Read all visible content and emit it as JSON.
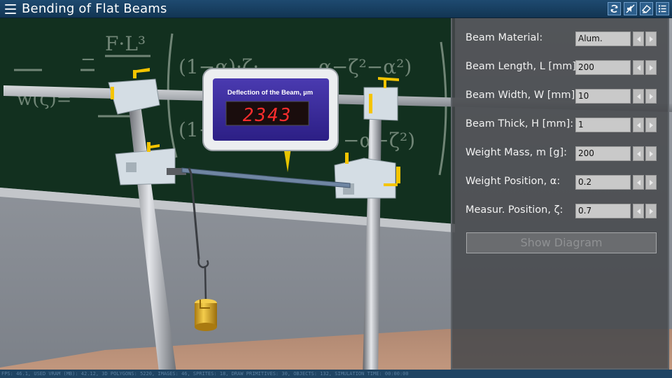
{
  "app": {
    "title": "Bending of Flat Beams"
  },
  "toolbar": {
    "icons": [
      "reset-icon",
      "sound-off-icon",
      "view-angle-icon",
      "settings-list-icon"
    ]
  },
  "instrument": {
    "gauge_title": "Deflection of the Beam, µm",
    "gauge_reading": "2343"
  },
  "blackboard": {
    "formula_parts": [
      "F·L³",
      "−",
      "w(ζ)=",
      "(1−α)·ζ·",
      "α−ζ²−α²)",
      "(1−",
      "−α−ζ²)"
    ]
  },
  "panel": {
    "rows": [
      {
        "label": "Beam Material:",
        "value": "Alum."
      },
      {
        "label": "Beam Length, L [mm]:",
        "value": "200"
      },
      {
        "label": "Beam Width, W [mm]:",
        "value": "10"
      },
      {
        "label": "Beam Thick, H [mm]:",
        "value": "1"
      },
      {
        "label": "Weight Mass, m [g]:",
        "value": "200"
      },
      {
        "label": "Weight Position, α:",
        "value": "0.2"
      },
      {
        "label": "Measur. Position, ζ:",
        "value": "0.7"
      }
    ],
    "show_diagram_label": "Show Diagram"
  },
  "statusbar": {
    "text": "FPS: 46.1, USED VRAM (MB): 42.12, 3D POLYGONS: 5220, IMAGES: 46, SPRITES: 18, DRAW PRIMITIVES: 30, OBJECTS: 132, SIMULATION TIME: 00:00:00"
  },
  "colors": {
    "titlebar": "#123553",
    "board": "#12301f",
    "gauge_face": "#3b2a9c",
    "digits": "#ff2d2d",
    "weight": "#d9a520",
    "clamp_yellow": "#f5c400"
  }
}
